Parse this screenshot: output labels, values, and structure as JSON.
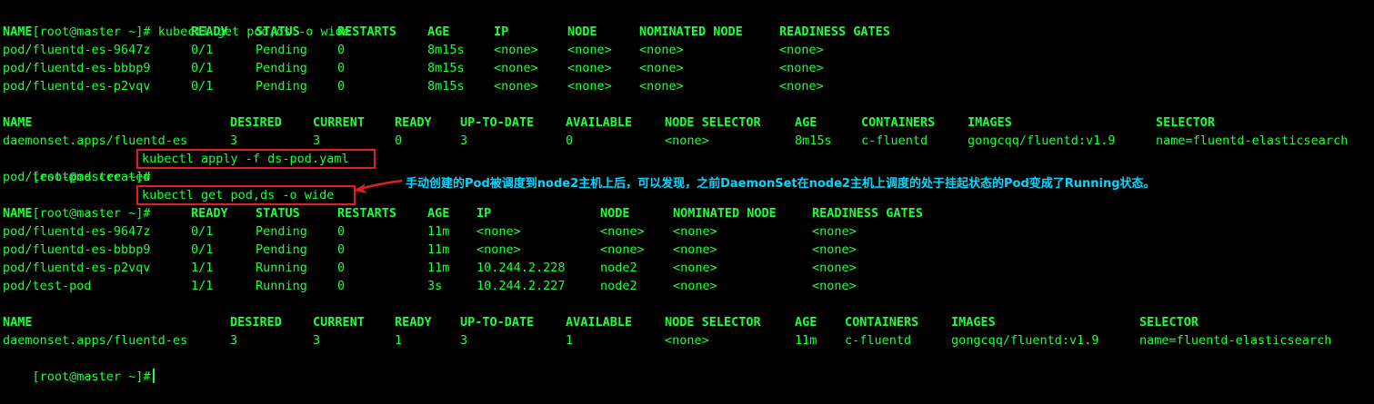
{
  "terminal": {
    "prompt": "[root@master ~]#",
    "block1": {
      "command": " kubectl get pod,ds -o wide",
      "pods": {
        "headers": [
          "NAME",
          "READY",
          "STATUS",
          "RESTARTS",
          "AGE",
          "IP",
          "NODE",
          "NOMINATED NODE",
          "READINESS GATES"
        ],
        "rows": [
          [
            "pod/fluentd-es-9647z",
            "0/1",
            "Pending",
            "0",
            "8m15s",
            "<none>",
            "<none>",
            "<none>",
            "<none>"
          ],
          [
            "pod/fluentd-es-bbbp9",
            "0/1",
            "Pending",
            "0",
            "8m15s",
            "<none>",
            "<none>",
            "<none>",
            "<none>"
          ],
          [
            "pod/fluentd-es-p2vqv",
            "0/1",
            "Pending",
            "0",
            "8m15s",
            "<none>",
            "<none>",
            "<none>",
            "<none>"
          ]
        ]
      },
      "daemonsets": {
        "headers": [
          "NAME",
          "DESIRED",
          "CURRENT",
          "READY",
          "UP-TO-DATE",
          "AVAILABLE",
          "NODE SELECTOR",
          "AGE",
          "CONTAINERS",
          "IMAGES",
          "SELECTOR"
        ],
        "rows": [
          [
            "daemonset.apps/fluentd-es",
            "3",
            "3",
            "0",
            "3",
            "0",
            "<none>",
            "8m15s",
            "c-fluentd",
            "gongcqq/fluentd:v1.9",
            "name=fluentd-elasticsearch"
          ]
        ]
      }
    },
    "apply": {
      "command": "kubectl apply -f ds-pod.yaml",
      "output": "pod/test-pod created"
    },
    "block2": {
      "command": "kubectl get pod,ds -o wide",
      "pods": {
        "headers": [
          "NAME",
          "READY",
          "STATUS",
          "RESTARTS",
          "AGE",
          "IP",
          "NODE",
          "NOMINATED NODE",
          "READINESS GATES"
        ],
        "rows": [
          [
            "pod/fluentd-es-9647z",
            "0/1",
            "Pending",
            "0",
            "11m",
            "<none>",
            "<none>",
            "<none>",
            "<none>"
          ],
          [
            "pod/fluentd-es-bbbp9",
            "0/1",
            "Pending",
            "0",
            "11m",
            "<none>",
            "<none>",
            "<none>",
            "<none>"
          ],
          [
            "pod/fluentd-es-p2vqv",
            "1/1",
            "Running",
            "0",
            "11m",
            "10.244.2.228",
            "node2",
            "<none>",
            "<none>"
          ],
          [
            "pod/test-pod",
            "1/1",
            "Running",
            "0",
            "3s",
            "10.244.2.227",
            "node2",
            "<none>",
            "<none>"
          ]
        ]
      },
      "daemonsets": {
        "headers": [
          "NAME",
          "DESIRED",
          "CURRENT",
          "READY",
          "UP-TO-DATE",
          "AVAILABLE",
          "NODE SELECTOR",
          "AGE",
          "CONTAINERS",
          "IMAGES",
          "SELECTOR"
        ],
        "rows": [
          [
            "daemonset.apps/fluentd-es",
            "3",
            "3",
            "1",
            "3",
            "1",
            "<none>",
            "11m",
            "c-fluentd",
            "gongcqq/fluentd:v1.9",
            "name=fluentd-elasticsearch"
          ]
        ]
      }
    },
    "annotation": "手动创建的Pod被调度到node2主机上后，可以发现，之前DaemonSet在node2主机上调度的处于挂起状态的Pod变成了Running状态。",
    "colors": {
      "text": "#1dff3a",
      "annotation": "#00d8ff",
      "highlight_box": "#e02020",
      "background": "#000000"
    }
  }
}
